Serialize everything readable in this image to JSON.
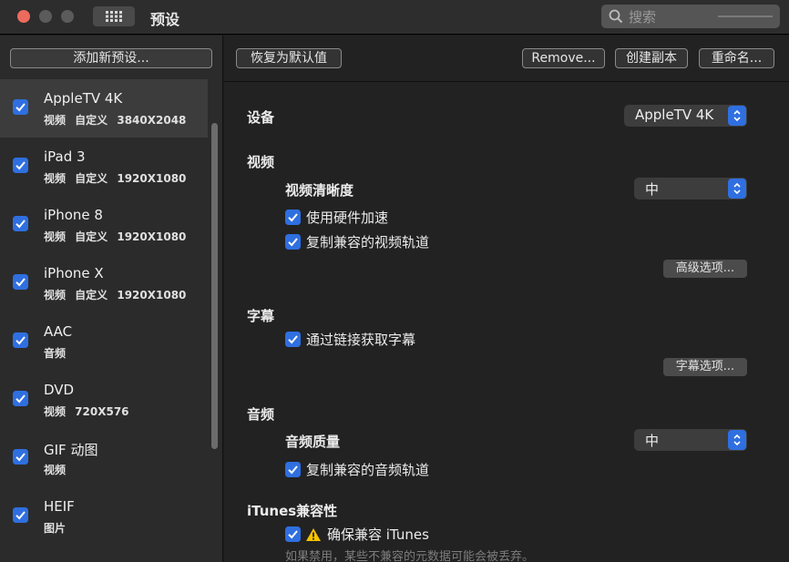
{
  "window": {
    "title": "预设"
  },
  "search": {
    "placeholder": "搜索"
  },
  "sidebar": {
    "add_label": "添加新预设...",
    "items": [
      {
        "name": "AppleTV 4K",
        "meta": "视频 自定义 3840X2048",
        "checked": true,
        "selected": true
      },
      {
        "name": "iPad 3",
        "meta": "视频 自定义 1920X1080",
        "checked": true
      },
      {
        "name": "iPhone 8",
        "meta": "视频 自定义 1920X1080",
        "checked": true
      },
      {
        "name": "iPhone X",
        "meta": "视频 自定义 1920X1080",
        "checked": true
      },
      {
        "name": "AAC",
        "meta": "音频",
        "checked": true
      },
      {
        "name": "DVD",
        "meta": "视频 720X576",
        "checked": true
      },
      {
        "name": "GIF 动图",
        "meta": "视频",
        "checked": true
      },
      {
        "name": "HEIF",
        "meta": "图片",
        "checked": true
      }
    ]
  },
  "toolbar": {
    "restore_label": "恢复为默认值",
    "remove_label": "Remove...",
    "duplicate_label": "创建副本",
    "rename_label": "重命名..."
  },
  "settings": {
    "device_label": "设备",
    "device_value": "AppleTV 4K",
    "video_section": "视频",
    "video_quality_label": "视频清晰度",
    "video_quality_value": "中",
    "hw_accel_label": "使用硬件加速",
    "copy_video_label": "复制兼容的视频轨道",
    "advanced_label": "高级选项...",
    "subtitles_section": "字幕",
    "fetch_subs_label": "通过链接获取字幕",
    "subs_options_label": "字幕选项...",
    "audio_section": "音频",
    "audio_quality_label": "音频质量",
    "audio_quality_value": "中",
    "copy_audio_label": "复制兼容的音频轨道",
    "itunes_section": "iTunes兼容性",
    "ensure_itunes_label": "确保兼容 iTunes",
    "itunes_note": "如果禁用，某些不兼容的元数据可能会被丢弃。"
  },
  "colors": {
    "accent": "#2f6fe0",
    "close": "#ed6a5e",
    "warning": "#f5c400"
  }
}
